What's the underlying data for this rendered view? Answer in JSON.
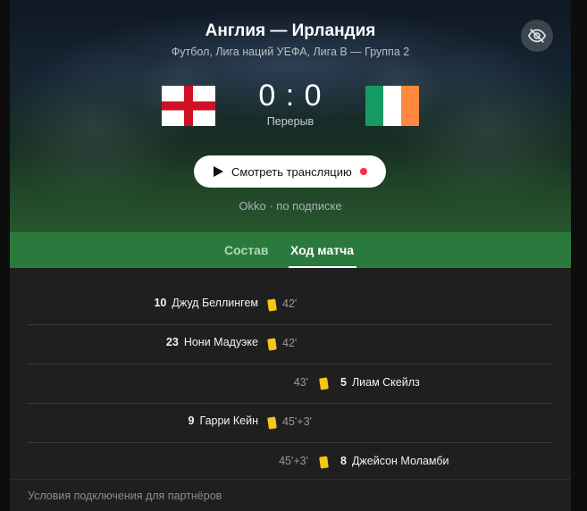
{
  "header": {
    "title": "Англия — Ирландия",
    "subtitle": "Футбол, Лига наций УЕФА, Лига B — Группа 2",
    "hide_icon": "eye-off-icon"
  },
  "score": {
    "home_team_flag": "england-flag",
    "away_team_flag": "ireland-flag",
    "value": "0 : 0",
    "status": "Перерыв"
  },
  "watch": {
    "label": "Смотреть трансляцию",
    "icon": "play-icon",
    "live_color": "#ff2b44",
    "provider": "Okko · по подписке"
  },
  "tabs": [
    {
      "label": "Состав",
      "active": false
    },
    {
      "label": "Ход матча",
      "active": true
    }
  ],
  "events": [
    {
      "side": "home",
      "number": "10",
      "player": "Джуд Беллингем",
      "minute": "42'",
      "card": "yellow"
    },
    {
      "side": "home",
      "number": "23",
      "player": "Нони Мадуэке",
      "minute": "42'",
      "card": "yellow"
    },
    {
      "side": "away",
      "number": "5",
      "player": "Лиам Скейлз",
      "minute": "43'",
      "card": "yellow"
    },
    {
      "side": "home",
      "number": "9",
      "player": "Гарри Кейн",
      "minute": "45'+3'",
      "card": "yellow"
    },
    {
      "side": "away",
      "number": "8",
      "player": "Джейсон Моламби",
      "minute": "45'+3'",
      "card": "yellow"
    }
  ],
  "footer": {
    "link": "Условия подключения для партнёров"
  },
  "colors": {
    "tab_bar": "#2b7a3d",
    "yellow_card": "#f5c518",
    "background": "#1f1f1f"
  }
}
